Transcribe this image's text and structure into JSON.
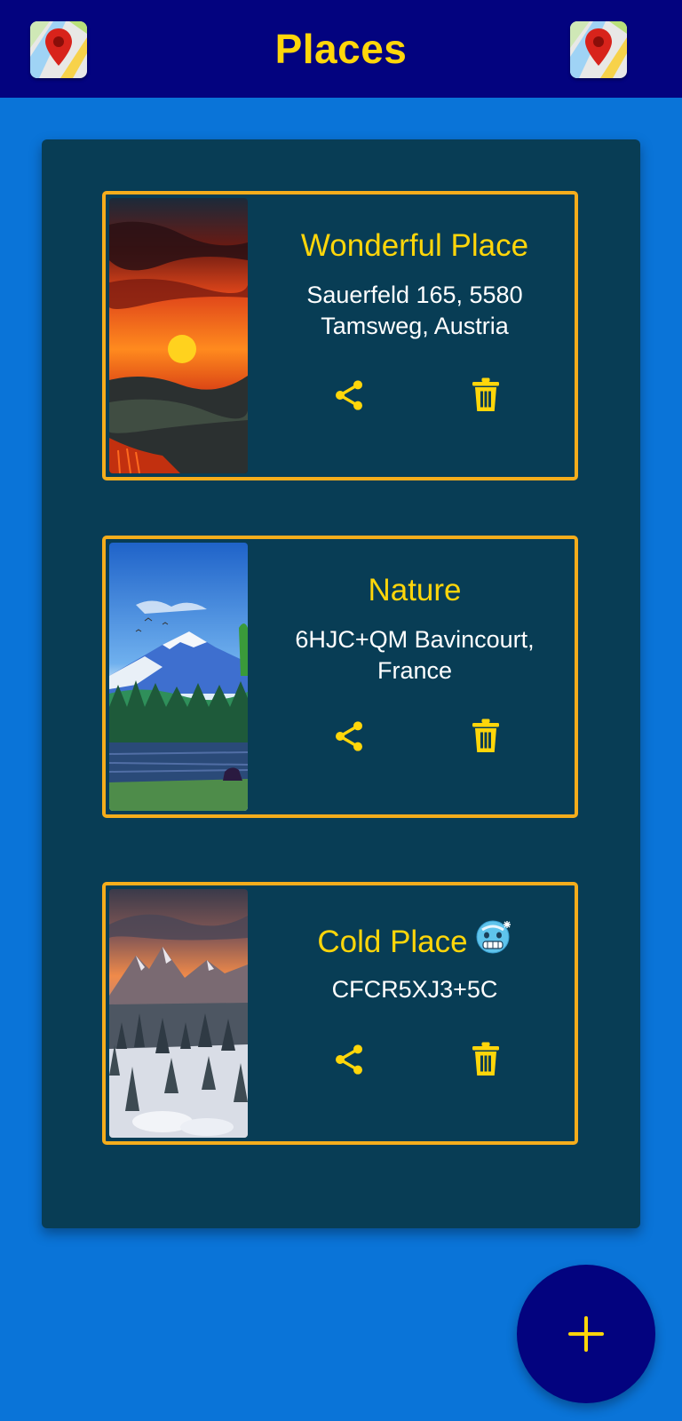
{
  "app_bar": {
    "title": "Places",
    "left_icon": "map-pin-icon",
    "right_icon": "map-pin-icon",
    "background": "#03037f",
    "title_color": "#ffd60a"
  },
  "places": [
    {
      "title": "Wonderful Place",
      "address": "Sauerfeld 165, 5580 Tamsweg, Austria",
      "image": "sunset-landscape-painting",
      "share_icon": "share-icon",
      "delete_icon": "trash-icon"
    },
    {
      "title": "Nature",
      "address": "6HJC+QM Bavincourt, France",
      "image": "mountain-lake-forest-illustration",
      "share_icon": "share-icon",
      "delete_icon": "trash-icon"
    },
    {
      "title": "Cold Place",
      "title_emoji": "cold-face-emoji",
      "address": "CFCR5XJ3+5C",
      "image": "snowy-mountain-forest-photo",
      "share_icon": "share-icon",
      "delete_icon": "trash-icon"
    }
  ],
  "fab": {
    "icon": "plus-icon"
  },
  "colors": {
    "page_background": "#0a74d8",
    "panel_background": "#083d55",
    "card_border": "#f5ad1c",
    "accent_yellow": "#ffd60a",
    "text_white": "#ffffff"
  }
}
